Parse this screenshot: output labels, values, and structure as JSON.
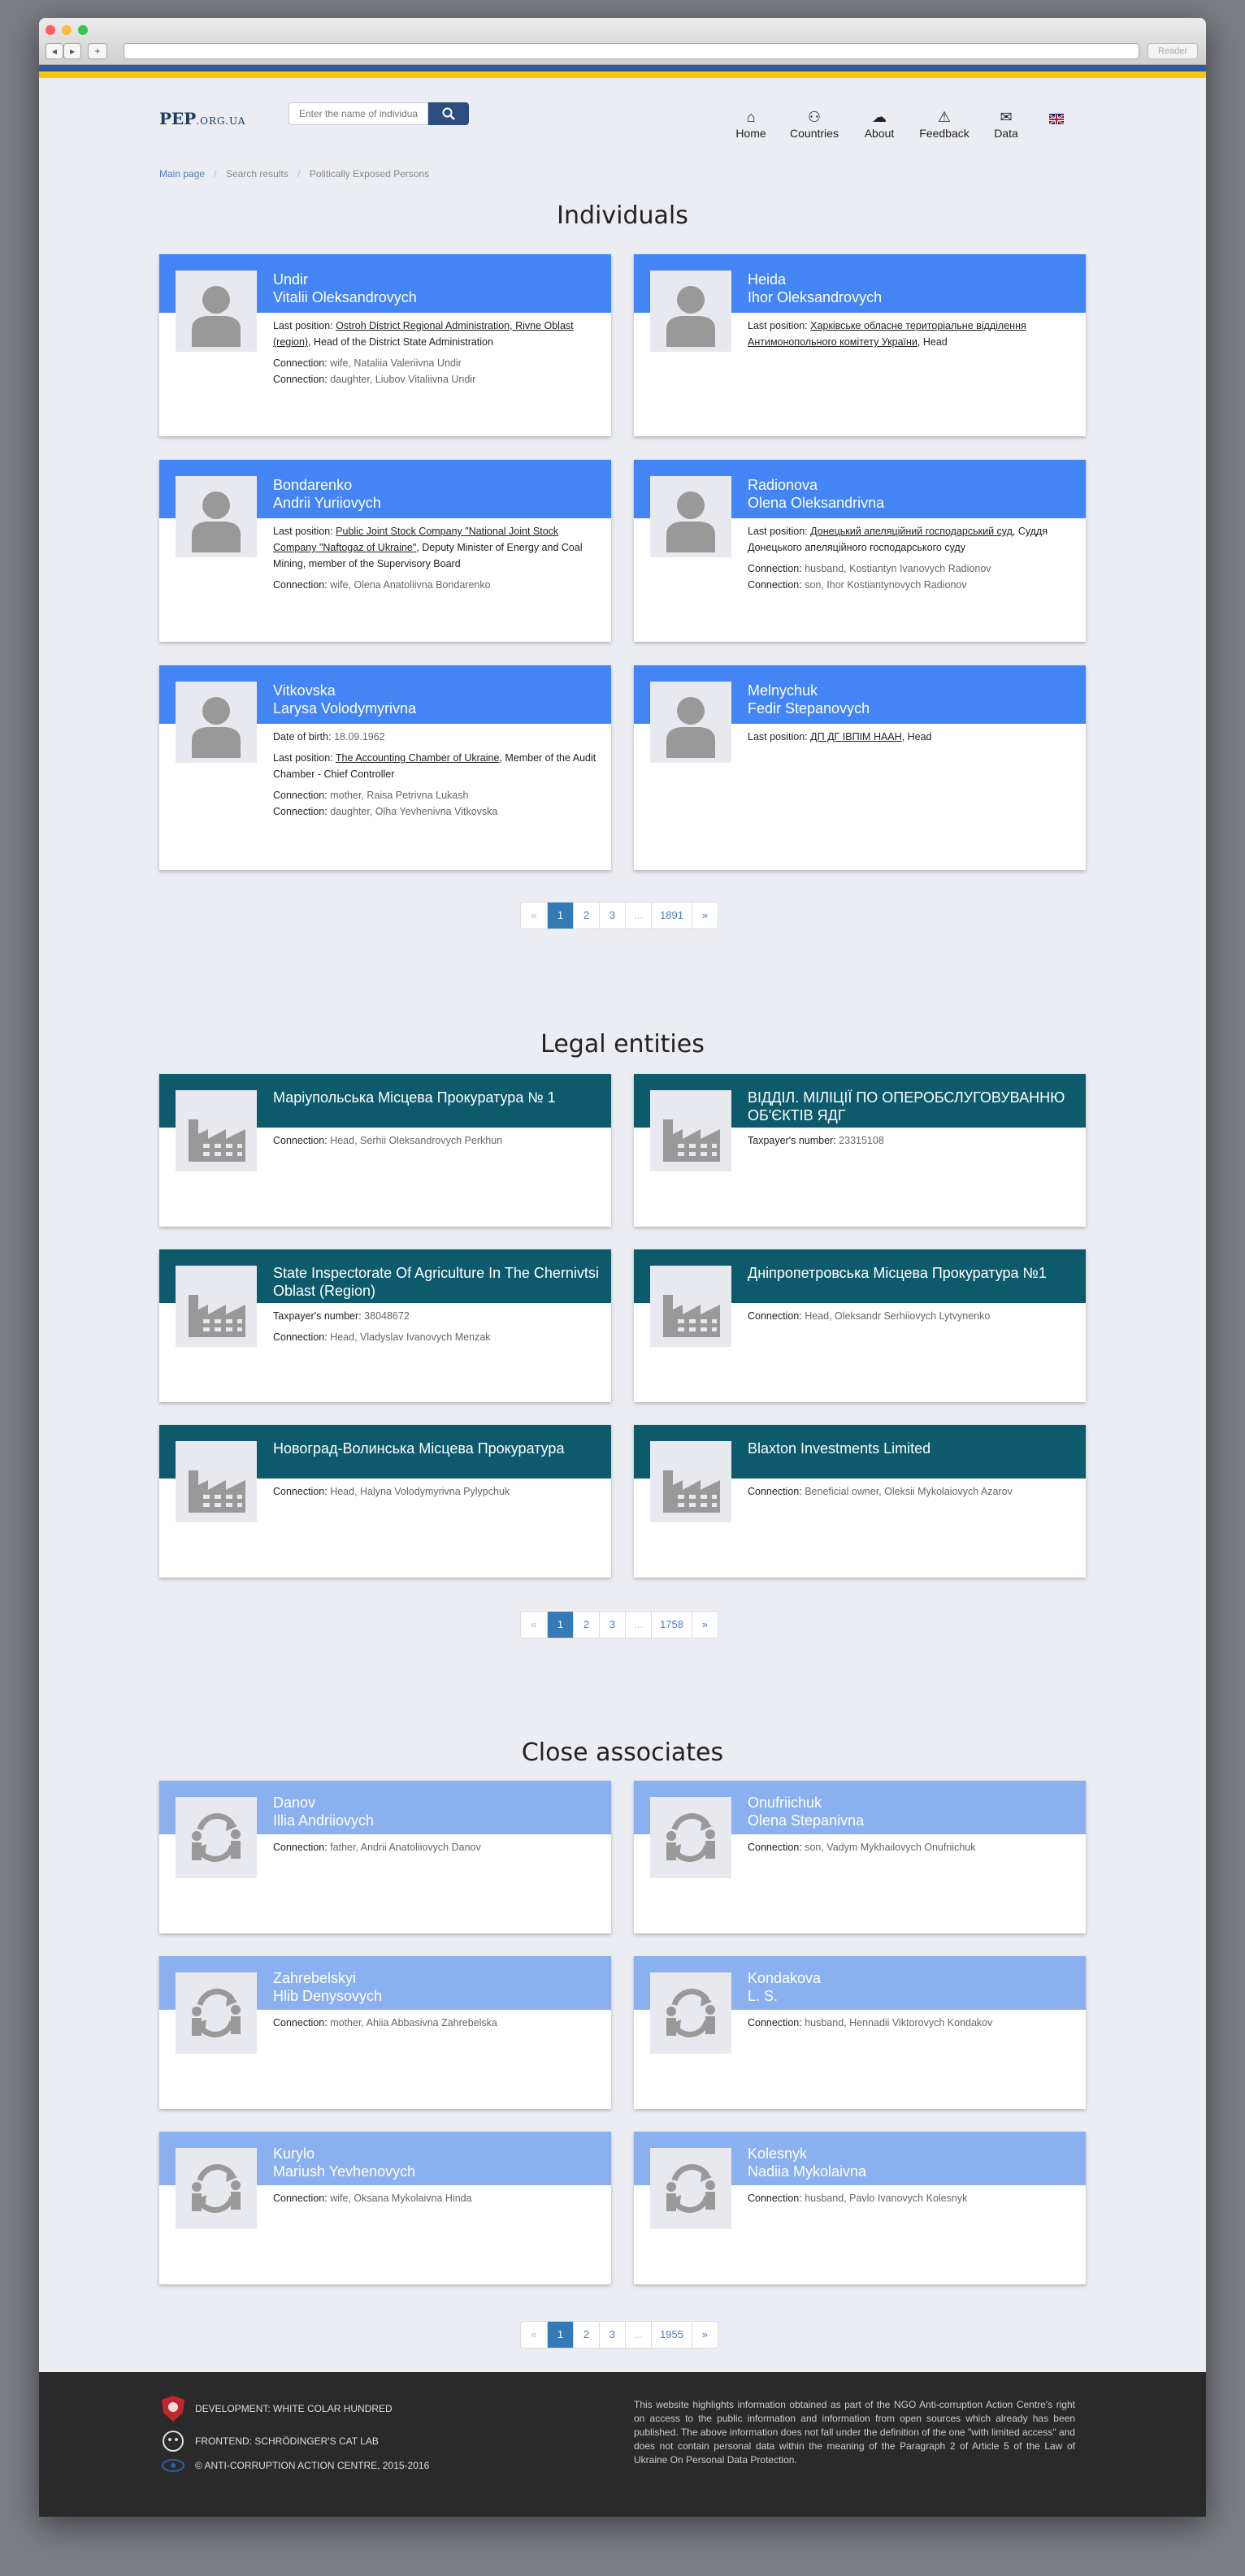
{
  "browser": {
    "reader_label": "Reader",
    "back": "◂",
    "forward": "▸",
    "add": "+"
  },
  "header": {
    "logo_main": "PEP",
    "logo_domain": ".ORG.UA",
    "search_placeholder": "Enter the name of individual",
    "nav": [
      {
        "label": "Home",
        "icon": "home-icon"
      },
      {
        "label": "Countries",
        "icon": "countries-icon"
      },
      {
        "label": "About",
        "icon": "about-icon"
      },
      {
        "label": "Feedback",
        "icon": "warning-icon"
      },
      {
        "label": "Data",
        "icon": "data-icon"
      }
    ]
  },
  "breadcrumb": [
    "Main page",
    "Search results",
    "Politically Exposed Persons"
  ],
  "sections": {
    "individuals": "Individuals",
    "legal": "Legal entities",
    "associates": "Close associates"
  },
  "individuals": [
    {
      "surname": "Undir",
      "name": "Vitalii Oleksandrovych",
      "last_position_label": "Last position:",
      "position_link": "Ostroh District Regional Administration, Rivne Oblast (region)",
      "position_rest": ", Head of the District State Administration",
      "connections": [
        [
          "Connection:",
          "wife, Nataliia Valeriivna Undir"
        ],
        [
          "Connection:",
          "daughter, Liubov Vitaliivna Undir"
        ]
      ]
    },
    {
      "surname": "Heida",
      "name": "Ihor Oleksandrovych",
      "last_position_label": "Last position:",
      "position_link": "Харківське обласне територіальне відділення Антимонопольного комітету України",
      "position_rest": ", Head",
      "connections": []
    },
    {
      "surname": "Bondarenko",
      "name": "Andrii Yuriiovych",
      "last_position_label": "Last position:",
      "position_link": "Public Joint Stock Company \"National Joint Stock Company \"Naftogaz of Ukraine\"",
      "position_rest": ", Deputy Minister of Energy and Coal Mining, member of the Supervisory Board",
      "connections": [
        [
          "Connection:",
          "wife, Olena Anatoliivna Bondarenko"
        ]
      ]
    },
    {
      "surname": "Radionova",
      "name": "Olena Oleksandrivna",
      "last_position_label": "Last position:",
      "position_link": "Донецький апеляційний господарський суд",
      "position_rest": ", Суддя Донецького апеляційного господарського суду",
      "connections": [
        [
          "Connection:",
          "husband, Kostiantyn Ivanovych Radionov"
        ],
        [
          "Connection:",
          "son, Ihor Kostiantynovych Radionov"
        ]
      ]
    },
    {
      "surname": "Vitkovska",
      "name": "Larysa Volodymyrivna",
      "dob_label": "Date of birth:",
      "dob": "18.09.1962",
      "last_position_label": "Last position:",
      "position_link": "The Accounting Chamber of Ukraine",
      "position_rest": ", Member of the Audit Chamber - Chief Controller",
      "connections": [
        [
          "Connection:",
          "mother, Raisa Petrivna Lukash"
        ],
        [
          "Connection:",
          "daughter, Olha Yevhenivna Vitkovska"
        ]
      ]
    },
    {
      "surname": "Melnychuk",
      "name": "Fedir Stepanovych",
      "last_position_label": "Last position:",
      "position_link": "ДП ДГ ІВПІМ НААН",
      "position_rest": ", Head",
      "connections": []
    }
  ],
  "legal": [
    {
      "name": "Маріупольська Місцева Прокуратура № 1",
      "lines": [
        [
          "Connection:",
          "Head, Serhii Oleksandrovych Perkhun"
        ]
      ]
    },
    {
      "name": "ВІДДІЛ. МІЛІЦІЇ ПО ОПЕРОБСЛУГОВУВАННЮ ОБ'ЄКТІВ ЯДГ",
      "lines": [
        [
          "Taxpayer's number:",
          "23315108"
        ]
      ]
    },
    {
      "name": "State Inspectorate Of Agriculture In The Chernivtsi Oblast (Region)",
      "lines": [
        [
          "Taxpayer's number:",
          "38048672"
        ],
        [
          "Connection:",
          "Head, Vladyslav Ivanovych Menzak"
        ]
      ]
    },
    {
      "name": "Дніпропетровська Місцева Прокуратура №1",
      "lines": [
        [
          "Connection:",
          "Head, Oleksandr Serhiiovych Lytvynenko"
        ]
      ]
    },
    {
      "name": "Новоград-Волинська Місцева Прокуратура",
      "lines": [
        [
          "Connection:",
          "Head, Halyna Volodymyrivna Pylypchuk"
        ]
      ]
    },
    {
      "name": "Blaxton Investments Limited",
      "lines": [
        [
          "Connection:",
          "Beneficial owner, Oleksii Mykolaiovych Azarov"
        ]
      ]
    }
  ],
  "associates": [
    {
      "surname": "Danov",
      "name": "Illia Andriiovych",
      "conn": [
        "Connection:",
        "father, Andrii Anatoliiovych Danov"
      ]
    },
    {
      "surname": "Onufriichuk",
      "name": "Olena Stepanivna",
      "conn": [
        "Connection:",
        "son, Vadym Mykhailovych Onufriichuk"
      ]
    },
    {
      "surname": "Zahrebelskyi",
      "name": "Hlib Denysovych",
      "conn": [
        "Connection:",
        "mother, Ahiia Abbasivna Zahrebelska"
      ]
    },
    {
      "surname": "Kondakova",
      "name": "L. S.",
      "conn": [
        "Connection:",
        "husband, Hennadii Viktorovych Kondakov"
      ]
    },
    {
      "surname": "Kurylo",
      "name": "Mariush Yevhenovych",
      "conn": [
        "Connection:",
        "wife, Oksana Mykolaivna Hinda"
      ]
    },
    {
      "surname": "Kolesnyk",
      "name": "Nadiia Mykolaivna",
      "conn": [
        "Connection:",
        "husband, Pavlo Ivanovych Kolesnyk"
      ]
    }
  ],
  "pagers": [
    [
      "«",
      "1",
      "2",
      "3",
      "...",
      "1891",
      "»"
    ],
    [
      "«",
      "1",
      "2",
      "3",
      "...",
      "1758",
      "»"
    ],
    [
      "«",
      "1",
      "2",
      "3",
      "...",
      "1955",
      "»"
    ]
  ],
  "footer": {
    "dev": "Development: White Colar Hundred",
    "frontend": "Frontend: Schrödinger's Cat Lab",
    "copy": "© Anti-Corruption Action Centre, 2015-2016",
    "text": "This website highlights information obtained as part of the NGO Anti-corruption Action Centre's right on access to the public information and information from open sources which already has been published. The above information does not fall under the definition of the one \"with limited access\" and does not contain personal data within the meaning of the Paragraph 2 of Article 5 of the Law of Ukraine On Personal Data Protection."
  },
  "colors": {
    "individual_header": "#4385f4",
    "legal_header": "#0e5a6d",
    "associate_header": "#8bb0f0",
    "flag_blue": "#2d5ba8",
    "flag_yellow": "#f7c80f"
  }
}
